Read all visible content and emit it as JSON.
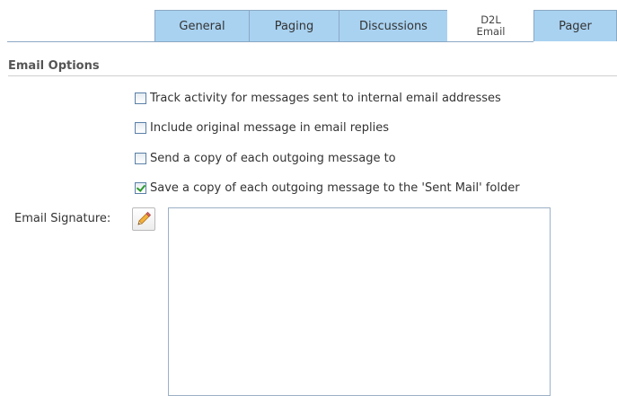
{
  "tabs": [
    {
      "label": "General",
      "active": false
    },
    {
      "label": "Paging",
      "active": false
    },
    {
      "label": "Discussions",
      "active": false
    },
    {
      "label": "D2L\nEmail",
      "active": true
    },
    {
      "label": "Pager",
      "active": false
    }
  ],
  "section": {
    "title": "Email Options"
  },
  "options": [
    {
      "label": "Track activity for messages sent to internal email addresses",
      "checked": false
    },
    {
      "label": "Include original message in email replies",
      "checked": false
    },
    {
      "label": "Send a copy of each outgoing message to",
      "checked": false
    },
    {
      "label": "Save a copy of each outgoing message to the 'Sent Mail' folder",
      "checked": true
    }
  ],
  "signature": {
    "label": "Email Signature:",
    "edit_icon": "pencil-icon",
    "value": ""
  },
  "colors": {
    "tab_bg": "#a9d2f1",
    "tab_border": "#8aa8c4",
    "check_mark": "#2a9a2a"
  }
}
